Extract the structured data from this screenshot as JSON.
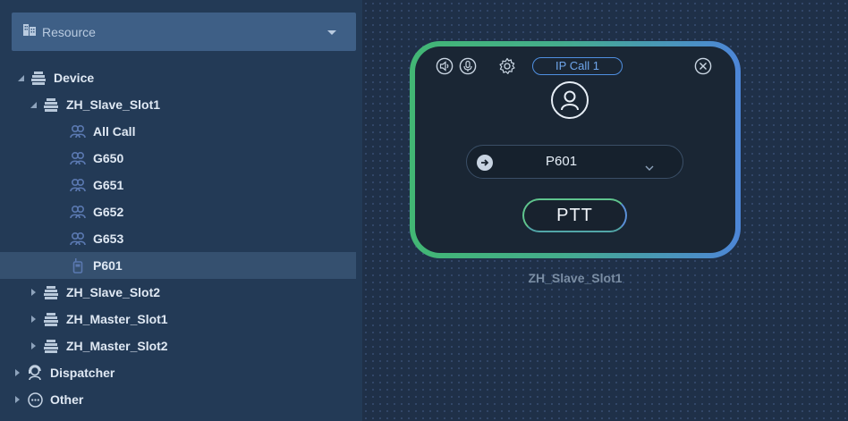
{
  "sidebar": {
    "resource_label": "Resource",
    "tree": [
      {
        "label": "Device",
        "icon": "server-icon",
        "level": 0,
        "expanded": true
      },
      {
        "label": "ZH_Slave_Slot1",
        "icon": "server-icon",
        "level": 1,
        "expanded": true
      },
      {
        "label": "All Call",
        "icon": "group-icon",
        "level": 2
      },
      {
        "label": "G650",
        "icon": "group-icon",
        "level": 2
      },
      {
        "label": "G651",
        "icon": "group-icon",
        "level": 2
      },
      {
        "label": "G652",
        "icon": "group-icon",
        "level": 2
      },
      {
        "label": "G653",
        "icon": "group-icon",
        "level": 2
      },
      {
        "label": "P601",
        "icon": "radio-icon",
        "level": 2,
        "selected": true
      },
      {
        "label": "ZH_Slave_Slot2",
        "icon": "server-icon",
        "level": 1,
        "expanded": false
      },
      {
        "label": "ZH_Master_Slot1",
        "icon": "server-icon",
        "level": 1,
        "expanded": false
      },
      {
        "label": "ZH_Master_Slot2",
        "icon": "server-icon",
        "level": 1,
        "expanded": false
      },
      {
        "label": "Dispatcher",
        "icon": "dispatcher-icon",
        "level": 0,
        "expanded": false
      },
      {
        "label": "Other",
        "icon": "other-icon",
        "level": 0,
        "expanded": false
      }
    ]
  },
  "call_card": {
    "call_label": "IP Call 1",
    "target_value": "P601",
    "ptt_label": "PTT",
    "device_caption": "ZH_Slave_Slot1"
  },
  "colors": {
    "accent_green": "#42b774",
    "accent_blue": "#4d86d8",
    "selected_row": "#35506f"
  }
}
